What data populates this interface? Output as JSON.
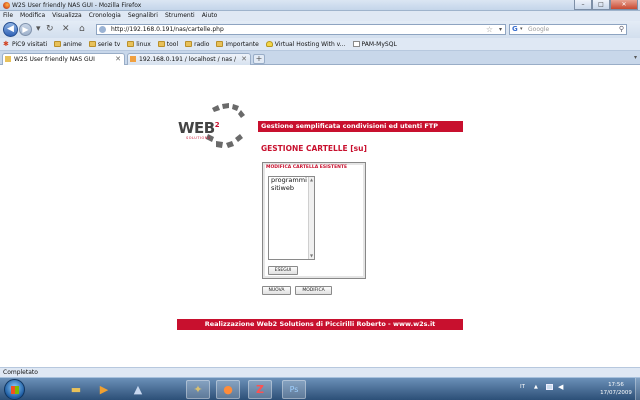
{
  "window": {
    "title": "W2S User friendly NAS GUI - Mozilla Firefox"
  },
  "menu": [
    "File",
    "Modifica",
    "Visualizza",
    "Cronologia",
    "Segnalibri",
    "Strumenti",
    "Aiuto"
  ],
  "nav": {
    "url": "http://192.168.0.191/nas/cartelle.php",
    "search_placeholder": "Google"
  },
  "bookmarks": [
    {
      "label": "PiC9 visitati",
      "icon": "star-icon"
    },
    {
      "label": "anime",
      "icon": "folder-icon"
    },
    {
      "label": "serie tv",
      "icon": "folder-icon"
    },
    {
      "label": "linux",
      "icon": "folder-icon"
    },
    {
      "label": "tool",
      "icon": "folder-icon"
    },
    {
      "label": "radio",
      "icon": "folder-icon"
    },
    {
      "label": "importante",
      "icon": "folder-icon"
    },
    {
      "label": "Virtual Hosting With v...",
      "icon": "bulb-icon"
    },
    {
      "label": "PAM-MySQL",
      "icon": "page-icon"
    }
  ],
  "tabs": [
    {
      "label": "W2S User friendly NAS GUI",
      "active": true
    },
    {
      "label": "192.168.0.191 / localhost / nas / cart...",
      "active": false
    }
  ],
  "page": {
    "logo_text": "WEB",
    "logo_sup": "2",
    "logo_sub": "SOLUTIONS",
    "header_bar": "Gestione semplificata condivisioni ed utenti FTP",
    "title": "GESTIONE CARTELLE [su]",
    "panel_title": "MODIFICA CARTELLA ESISTENTE",
    "folders": [
      "programmi",
      "sitiweb"
    ],
    "esegui_label": "ESEGUI",
    "nuova_label": "NUOVA",
    "modifica_label": "MODIFICA",
    "footer": "Realizzazione Web2 Solutions di Piccirilli Roberto - www.w2s.it"
  },
  "status": {
    "text": "Completato"
  },
  "taskbar": {
    "language": "IT",
    "time": "17:56",
    "date": "17/07/2009"
  },
  "colors": {
    "brand_red": "#c8102e"
  }
}
